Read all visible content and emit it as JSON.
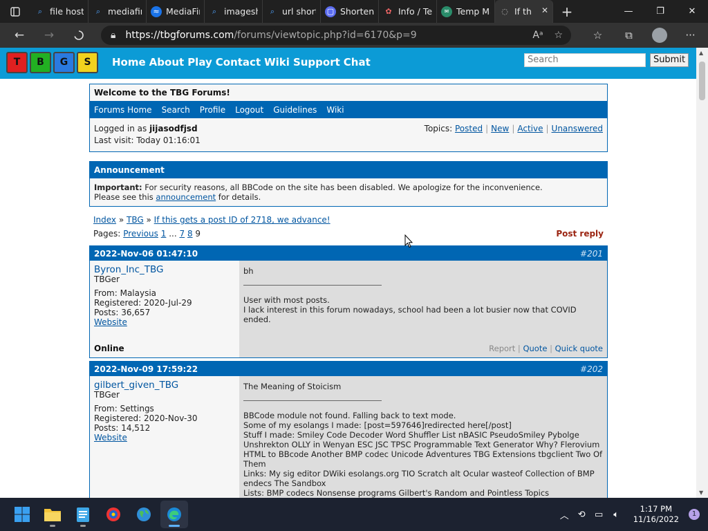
{
  "browser": {
    "tabs": [
      {
        "title": "file host",
        "icon": "search-icon"
      },
      {
        "title": "mediafire",
        "icon": "search-icon"
      },
      {
        "title": "MediaFire",
        "icon": "mediafire-icon"
      },
      {
        "title": "imagesha",
        "icon": "search-icon"
      },
      {
        "title": "url short",
        "icon": "search-icon"
      },
      {
        "title": "Shortene",
        "icon": "shortener-icon"
      },
      {
        "title": "Info / Tex",
        "icon": "info-icon"
      },
      {
        "title": "Temp Ma",
        "icon": "temp-mail-icon"
      },
      {
        "title": "If th",
        "icon": "loading-icon",
        "active": true
      }
    ],
    "url_domain": "https://tbgforums.com",
    "url_path": "/forums/viewtopic.php?id=6170&p=9"
  },
  "site": {
    "logo_keys": [
      "T",
      "B",
      "G",
      "S"
    ],
    "nav": [
      "Home",
      "About",
      "Play",
      "Contact",
      "Wiki",
      "Support",
      "Chat"
    ],
    "search_placeholder": "Search",
    "submit_label": "Submit"
  },
  "welcome": {
    "title": "Welcome to the TBG Forums!",
    "links": [
      "Forums Home",
      "Search",
      "Profile",
      "Logout",
      "Guidelines",
      "Wiki"
    ],
    "logged_in_label": "Logged in as",
    "username": "jijasodfjsd",
    "last_visit": "Last visit: Today 01:16:01",
    "topics_label": "Topics:",
    "topic_links": [
      "Posted",
      "New",
      "Active",
      "Unanswered"
    ]
  },
  "announcement": {
    "title": "Announcement",
    "important": "Important:",
    "text1": "For security reasons, all BBCode on the site has been disabled. We apologize for the inconvenience.",
    "text2_pre": "Please see this",
    "link": "announcement",
    "text2_post": "for details."
  },
  "breadcrumb": {
    "index": "Index",
    "forum": "TBG",
    "topic": "If this gets a post ID of 2718, we advance!"
  },
  "pagination": {
    "label": "Pages:",
    "previous": "Previous",
    "pages": [
      "1",
      "...",
      "7",
      "8"
    ],
    "current": "9",
    "post_reply": "Post reply"
  },
  "posts": [
    {
      "date": "2022-Nov-06 01:47:10",
      "number": "#201",
      "author": "Byron_Inc_TBG",
      "role": "TBGer",
      "from": "From: Malaysia",
      "registered": "Registered: 2020-Jul-29",
      "posts": "Posts: 36,657",
      "website": "Website",
      "status": "Online",
      "message": "bh",
      "signature": [
        "User with most posts.",
        "I lack interest in this forum nowadays, school had been a lot busier now that COVID ended."
      ],
      "actions": {
        "report": "Report",
        "quote": "Quote",
        "quick_quote": "Quick quote"
      }
    },
    {
      "date": "2022-Nov-09 17:59:22",
      "number": "#202",
      "author": "gilbert_given_TBG",
      "role": "TBGer",
      "from": "From: Settings",
      "registered": "Registered: 2020-Nov-30",
      "posts": "Posts: 14,512",
      "website": "Website",
      "message": "The Meaning of Stoicism",
      "signature": [
        "BBCode module not found. Falling back to text mode.",
        "Some of my esolangs I made: [post=597646]redirected here[/post]",
        "Stuff I made: Smiley Code Decoder Word Shuffler List nBASIC PseudoSmiley Pybolge Unshrekton OLLY in Wenyan ESC JSC TPSC Programmable Text Generator Why? Flerovium HTML to BBcode Another BMP codec Unicode Adventures TBG Extensions tbgclient Two Of Them",
        "Links: My sig editor DWiki esolangs.org TIO Scratch alt Ocular wasteof Collection of BMP endecs The Sandbox",
        "Lists: BMP codecs Nonsense programs Gilbert's Random and Pointless Topics"
      ]
    }
  ],
  "taskbar": {
    "apps": [
      "windows-start-icon",
      "file-explorer-icon",
      "notepad-icon",
      "app-icon",
      "earth-icon",
      "edge-icon"
    ],
    "time": "1:17 PM",
    "date": "11/16/2022",
    "notifications": "1"
  }
}
